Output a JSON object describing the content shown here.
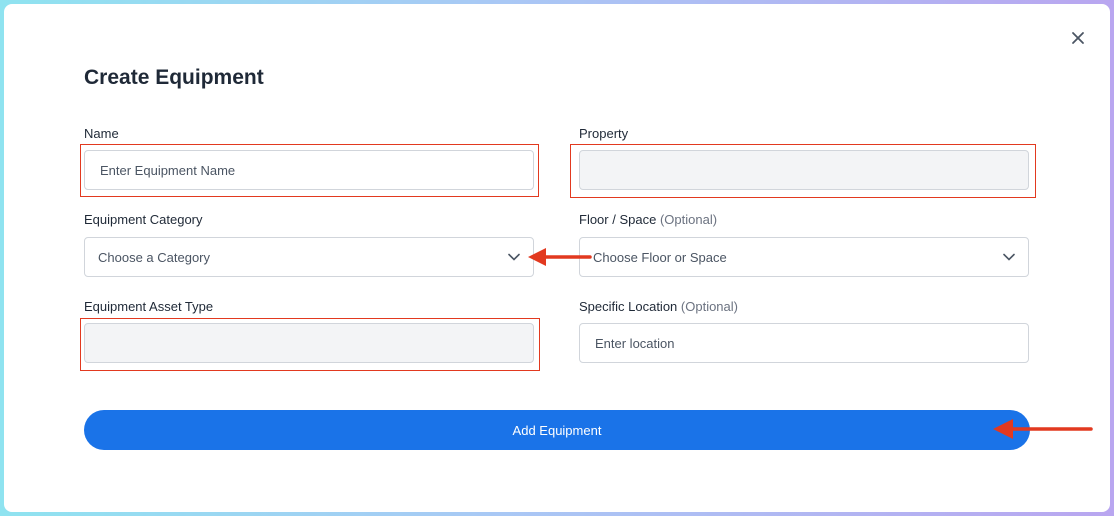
{
  "modal": {
    "title": "Create Equipment",
    "close_icon": "close-icon"
  },
  "form": {
    "name": {
      "label": "Name",
      "placeholder": "Enter Equipment Name",
      "value": ""
    },
    "property": {
      "label": "Property",
      "value": ""
    },
    "equipment_category": {
      "label": "Equipment Category",
      "selected": "Choose a Category",
      "icon": "chevron-down-icon"
    },
    "floor_space": {
      "label": "Floor / Space",
      "optional": "(Optional)",
      "selected": "Choose Floor or Space",
      "icon": "chevron-down-icon"
    },
    "equipment_asset_type": {
      "label": "Equipment Asset Type",
      "value": ""
    },
    "specific_location": {
      "label": "Specific Location",
      "optional": "(Optional)",
      "placeholder": "Enter location",
      "value": ""
    },
    "submit_label": "Add Equipment"
  },
  "annotations": {
    "highlight_color": "#e2391f",
    "arrow_color": "#e2391f",
    "primary_color": "#1a73e8"
  }
}
